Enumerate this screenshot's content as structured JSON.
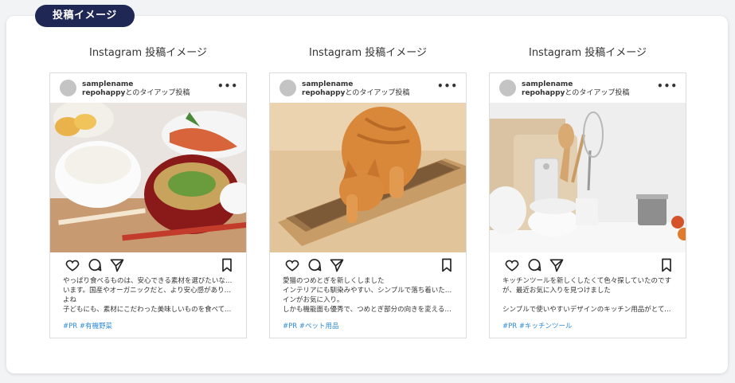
{
  "section": {
    "badge": "投稿イメージ"
  },
  "posts": [
    {
      "title": "Instagram 投稿イメージ",
      "account": "samplename",
      "tie_brand": "repohappy",
      "tie_suffix": "とのタイアップ投稿",
      "more": "•••",
      "photo": "japanese-breakfast-photo",
      "caption": [
        "やっぱり食べるものは、安心できる素材を選びたいなと思",
        "います。国産やオーガニックだと、より安心感があります",
        "よね",
        "子どもにも、素材にこだわった美味しいものを食べても…"
      ],
      "tags": "#PR #有機野菜"
    },
    {
      "title": "Instagram 投稿イメージ",
      "account": "samplename",
      "tie_brand": "repohappy",
      "tie_suffix": "とのタイアップ投稿",
      "more": "•••",
      "photo": "cat-scratcher-photo",
      "caption": [
        "愛猫のつめとぎを新しくしました",
        "インテリアにも馴染みやすい、シンプルで落ち着いたデザ",
        "インがお気に入り。",
        "しかも機能面も優秀で、つめとぎ部分の向きを変えるこ…"
      ],
      "tags": "#PR #ペット用品"
    },
    {
      "title": "Instagram 投稿イメージ",
      "account": "samplename",
      "tie_brand": "repohappy",
      "tie_suffix": "とのタイアップ投稿",
      "more": "•••",
      "photo": "kitchen-tools-photo",
      "caption": [
        "キッチンツールを新しくしたくて色々探していたのです",
        "が、最近お気に入りを見つけました",
        "",
        "シンプルで使いやすいデザインのキッチン用品がとても…"
      ],
      "tags": "#PR #キッチンツール"
    }
  ],
  "icons": [
    "heart-icon",
    "comment-icon",
    "share-icon",
    "bookmark-icon"
  ],
  "colors": {
    "badge_bg": "#1f2754",
    "hashtag": "#2d8ad6",
    "avatar": "#c4c4c4"
  }
}
